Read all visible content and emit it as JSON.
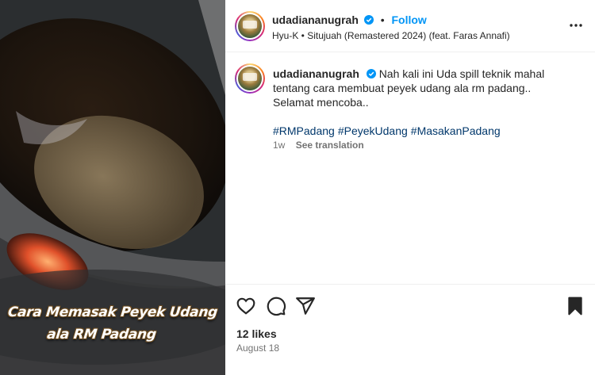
{
  "media": {
    "overlay_line1": "Cara Memasak Peyek Udang",
    "overlay_line2": "ala RM Padang"
  },
  "post_header": {
    "username": "udadiananugrah",
    "separator": "•",
    "follow_label": "Follow",
    "audio": "Hyu-K • Situjuah (Remastered 2024) (feat. Faras Annafi)"
  },
  "caption": {
    "username": "udadiananugrah",
    "text": "Nah kali ini Uda spill teknik mahal tentang cara membuat peyek udang ala rm padang..\nSelamat mencoba..",
    "hashtags": [
      "#RMPadang",
      "#PeyekUdang",
      "#MasakanPadang"
    ],
    "age": "1w",
    "see_translation": "See translation"
  },
  "footer": {
    "likes": "12 likes",
    "date": "August 18"
  },
  "colors": {
    "follow": "#0095f6",
    "verified": "#0095f6",
    "hashtag": "#00376b",
    "muted": "#737373"
  }
}
